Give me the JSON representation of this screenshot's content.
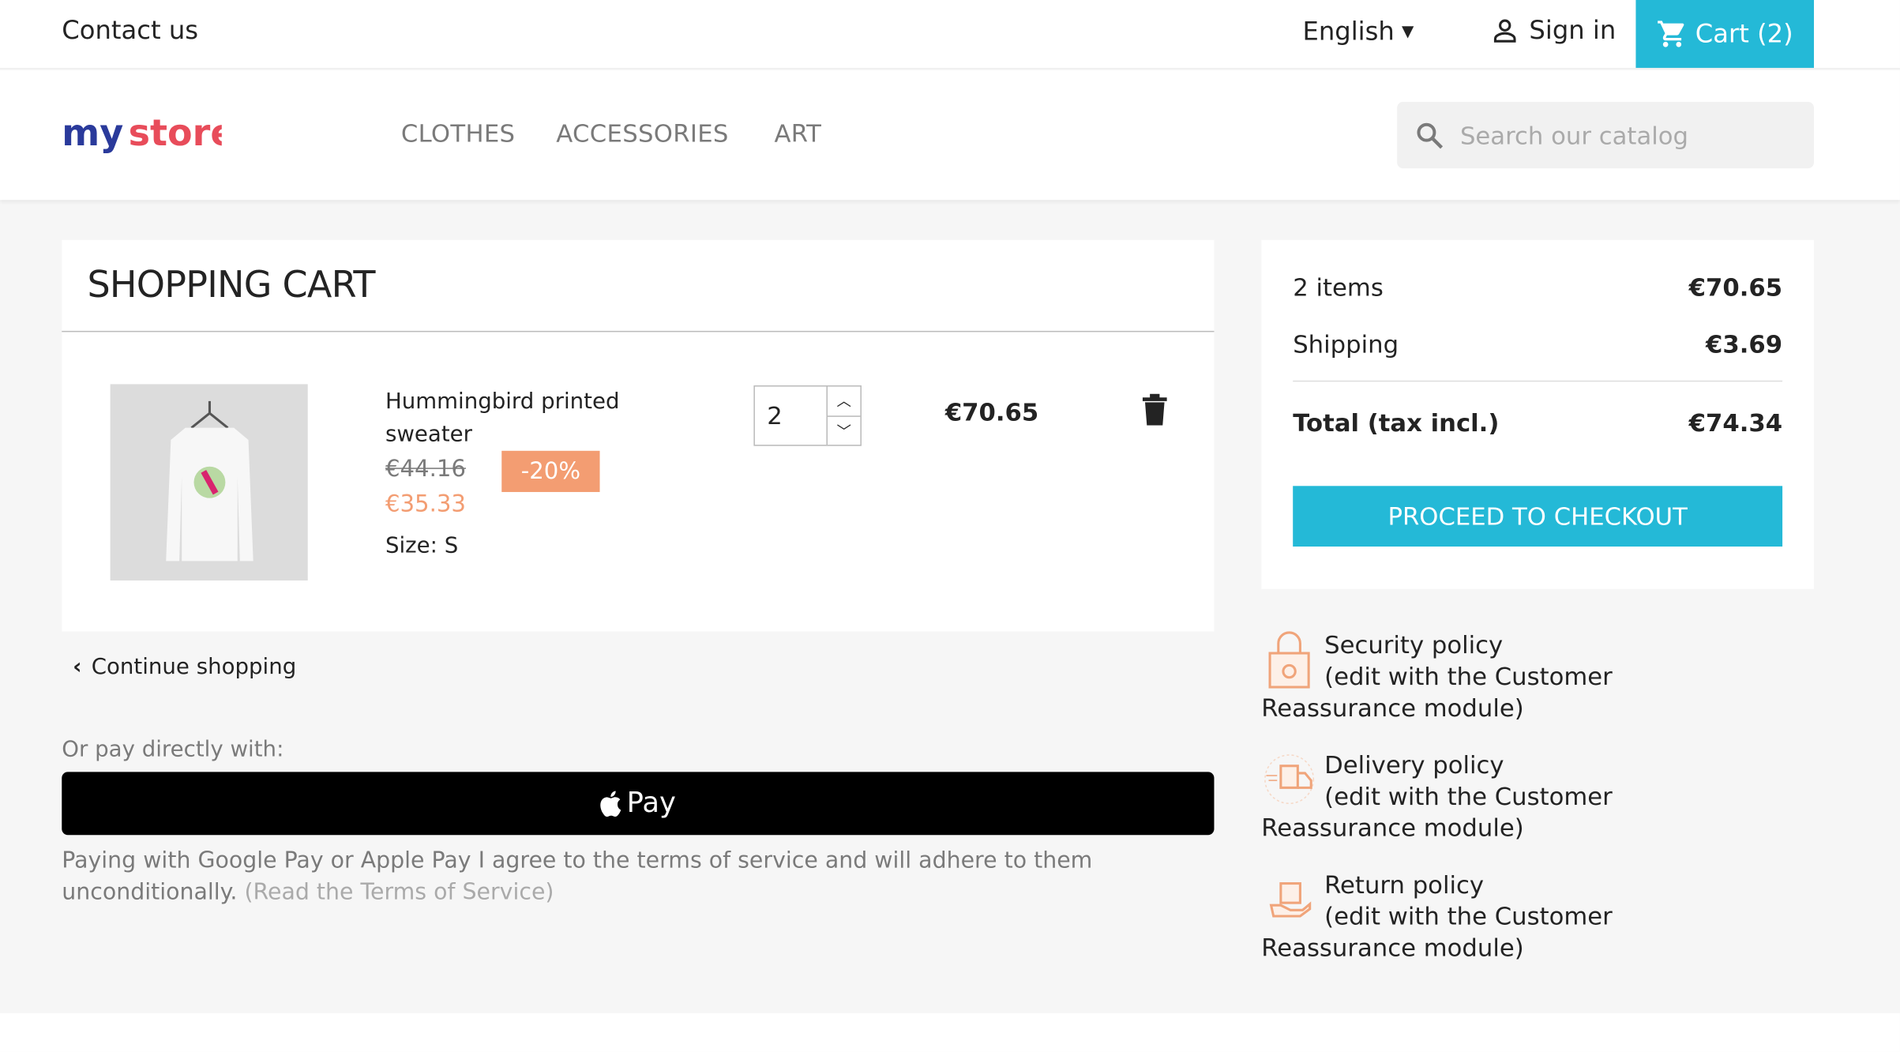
{
  "topbar": {
    "contact": "Contact us",
    "language": "English",
    "sign_in": "Sign in",
    "cart": "Cart (2)"
  },
  "header": {
    "logo": "my store",
    "nav": [
      "CLOTHES",
      "ACCESSORIES",
      "ART"
    ],
    "search_placeholder": "Search our catalog"
  },
  "cart": {
    "title": "SHOPPING CART",
    "items": [
      {
        "name": "Hummingbird printed sweater",
        "regular_price": "€44.16",
        "discount": "-20%",
        "price": "€35.33",
        "size_label": "Size:",
        "size": "S",
        "quantity": "2",
        "total": "€70.65"
      }
    ]
  },
  "continue_shopping": "Continue shopping",
  "express": {
    "label": "Or pay directly with:",
    "apple_pay": "Pay",
    "terms": "Paying with Google Pay or Apple Pay I agree to the terms of service and will adhere to them unconditionally.",
    "terms_link": "(Read the Terms of Service)"
  },
  "summary": {
    "items_label": "2 items",
    "items_value": "€70.65",
    "shipping_label": "Shipping",
    "shipping_value": "€3.69",
    "total_label": "Total (tax incl.)",
    "total_value": "€74.34",
    "checkout": "PROCEED TO CHECKOUT"
  },
  "reassurance": [
    {
      "title": "Security policy",
      "desc": "(edit with the Customer Reassurance module)",
      "icon": "lock-icon"
    },
    {
      "title": "Delivery policy",
      "desc": "(edit with the Customer Reassurance module)",
      "icon": "truck-icon"
    },
    {
      "title": "Return policy",
      "desc": "(edit with the Customer Reassurance module)",
      "icon": "hand-box-icon"
    }
  ],
  "colors": {
    "accent": "#24b9d7",
    "discount": "#f39d72",
    "background": "#f6f6f6"
  }
}
